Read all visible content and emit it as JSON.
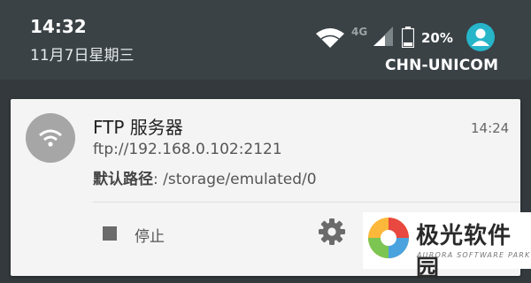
{
  "status_bar": {
    "time": "14:32",
    "date": "11月7日星期三",
    "network_type": "4G",
    "battery": "20%",
    "carrier": "CHN-UNICOM",
    "icons": [
      "wifi-icon",
      "cellular-signal-icon",
      "battery-icon",
      "user-avatar-icon"
    ],
    "accent_color": "#26b5c9"
  },
  "notification": {
    "title": "FTP 服务器",
    "time": "14:24",
    "address": "ftp://192.168.0.102:2121",
    "path_label": "默认路径",
    "path_value": ": /storage/emulated/0",
    "app_icon": "wifi-icon",
    "actions": [
      {
        "label": "停止",
        "icon": "stop-icon"
      },
      {
        "label": "",
        "icon": "settings-gear-icon"
      }
    ]
  },
  "watermark": {
    "name": "极光软件园",
    "subtitle": "AURORA SOFTWARE PARK"
  }
}
